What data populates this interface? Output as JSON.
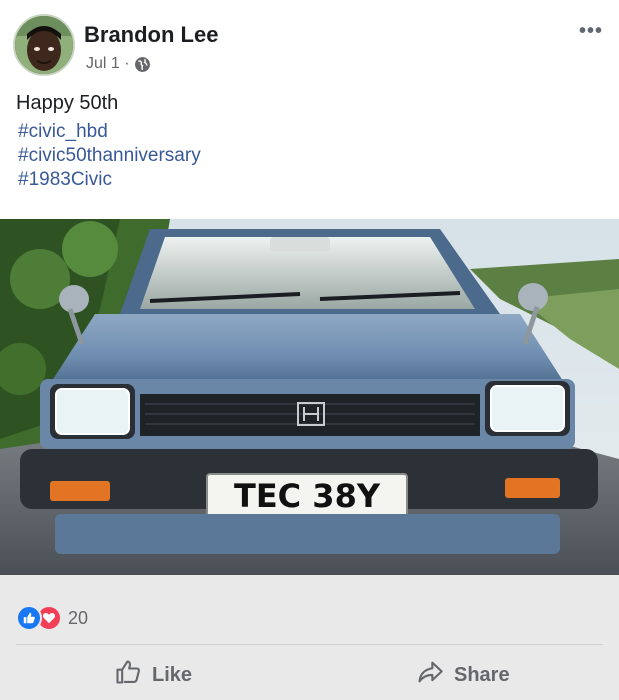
{
  "post": {
    "author": "Brandon Lee",
    "date": "Jul 1 ·",
    "privacy_icon": "globe-icon",
    "more_label": "•••",
    "text": "Happy 50th",
    "hashtags": [
      "#civic_hbd",
      "#civic50thanniversary",
      "#1983Civic"
    ]
  },
  "photo": {
    "license_plate": "TEC 38Y"
  },
  "reactions": {
    "icons": [
      "like-icon",
      "love-icon"
    ],
    "count": "20"
  },
  "actions": {
    "like_label": "Like",
    "share_label": "Share"
  },
  "colors": {
    "link": "#385898",
    "like_blue": "#1877f2",
    "love_red": "#f33e58",
    "footer_bg": "#e9e9ea"
  }
}
